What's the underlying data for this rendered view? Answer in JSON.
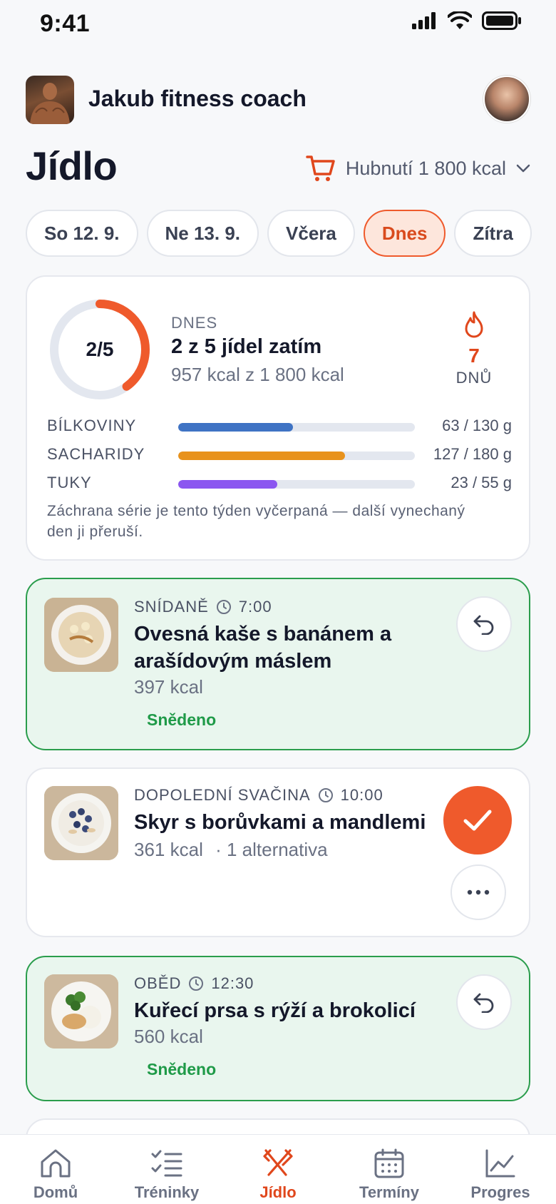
{
  "status_bar": {
    "time": "9:41"
  },
  "header": {
    "coach_name": "Jakub fitness coach"
  },
  "page": {
    "title": "Jídlo",
    "plan": "Hubnutí 1 800 kcal"
  },
  "date_tabs": [
    {
      "label": "So 12. 9.",
      "active": false
    },
    {
      "label": "Ne 13. 9.",
      "active": false
    },
    {
      "label": "Včera",
      "active": false
    },
    {
      "label": "Dnes",
      "active": true
    },
    {
      "label": "Zítra",
      "active": false
    }
  ],
  "summary": {
    "ring_label": "2/5",
    "ring_progress": 0.4,
    "eyebrow": "DNES",
    "title": "2 z 5 jídel zatím",
    "subtitle": "957 kcal z 1 800 kcal",
    "streak_value": "7",
    "streak_unit": "DNŮ",
    "macros": [
      {
        "name": "BÍLKOVINY",
        "value": "63 / 130 g",
        "fraction": 0.485,
        "color": "#3f73c4"
      },
      {
        "name": "SACHARIDY",
        "value": "127 / 180 g",
        "fraction": 0.706,
        "color": "#e8921c"
      },
      {
        "name": "TUKY",
        "value": "23 / 55 g",
        "fraction": 0.418,
        "color": "#8b56f0"
      }
    ],
    "note": "Záchrana série je tento týden vyčerpaná — další vynechaný den ji přeruší."
  },
  "meals": [
    {
      "type": "SNÍDANĚ",
      "time": "7:00",
      "name": "Ovesná kaše s banánem a arašídovým máslem",
      "kcal": "397 kcal",
      "status": "Snědeno",
      "eaten": true
    },
    {
      "type": "DOPOLEDNÍ SVAČINA",
      "time": "10:00",
      "name": "Skyr s borůvkami a mandlemi",
      "kcal": "361 kcal",
      "alternatives": "· 1 alternativa",
      "eaten": false
    },
    {
      "type": "OBĚD",
      "time": "12:30",
      "name": "Kuřecí prsa s rýží a brokolicí",
      "kcal": "560 kcal",
      "status": "Snědeno",
      "eaten": true
    }
  ],
  "nav": [
    {
      "label": "Domů",
      "icon": "home-icon",
      "active": false
    },
    {
      "label": "Tréninky",
      "icon": "checklist-icon",
      "active": false
    },
    {
      "label": "Jídlo",
      "icon": "fork-knife-icon",
      "active": true
    },
    {
      "label": "Termíny",
      "icon": "calendar-icon",
      "active": false
    },
    {
      "label": "Progres",
      "icon": "chart-icon",
      "active": false
    }
  ],
  "colors": {
    "accent": "#ef5a2c",
    "eaten_green": "#1f9a48"
  }
}
